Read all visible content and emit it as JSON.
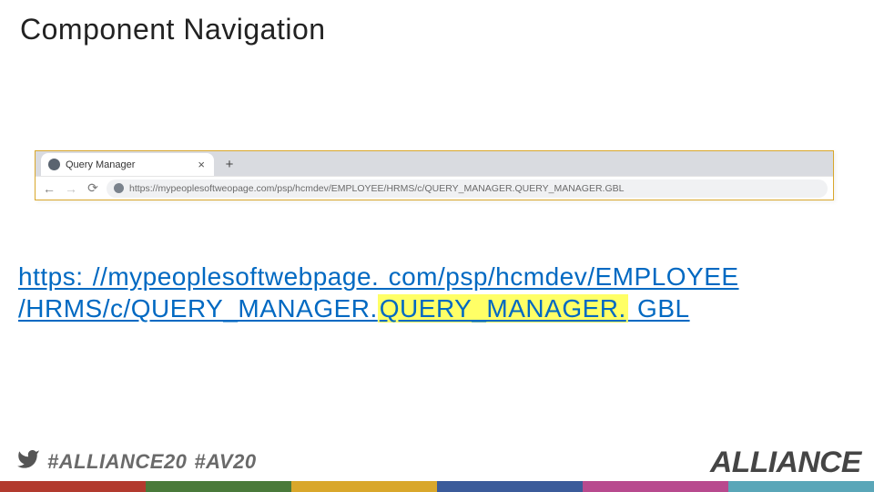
{
  "title": "Component Navigation",
  "browser": {
    "tab_title": "Query Manager",
    "tab_close": "×",
    "new_tab": "+",
    "nav": {
      "back": "←",
      "forward": "→",
      "reload": "⟳"
    },
    "address_bar_url": "https://mypeoplesoftweopage.com/psp/hcmdev/EMPLOYEE/HRMS/c/QUERY_MANAGER.QUERY_MANAGER.GBL"
  },
  "url_display": {
    "part1": "https: //mypeoplesoftwebpage. com/psp/hcmdev/EMPLOYEE",
    "part2_prefix": "/HRMS/c/QUERY_MANAGER.",
    "part2_highlight": "QUERY_MANAGER.",
    "part2_suffix": " GBL"
  },
  "footer": {
    "hashtag1": "#ALLIANCE20",
    "hashtag2": "#AV20",
    "brand": "ALLIANCE"
  }
}
